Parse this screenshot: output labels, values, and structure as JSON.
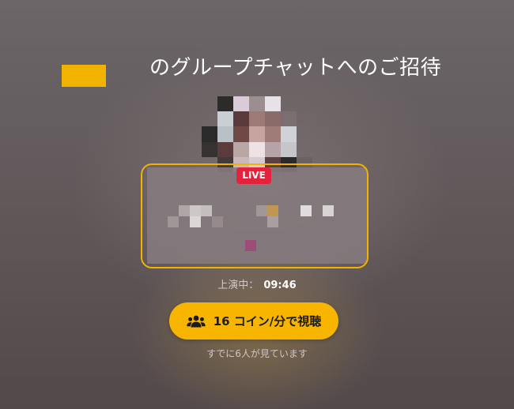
{
  "invite": {
    "title": "のグループチャットへのご招待",
    "live_badge": "LIVE",
    "status_label": "上演中：",
    "elapsed_time": "09:46",
    "watch_button_label": "16 コイン/分で視聴",
    "viewers_text": "すでに6人が見ています"
  },
  "colors": {
    "accent": "#f8b500",
    "live": "#e4223b"
  },
  "icons": {
    "watch_button": "group-users-icon"
  }
}
